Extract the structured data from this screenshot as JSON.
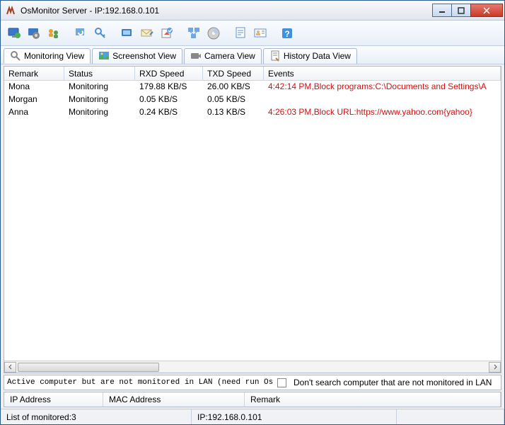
{
  "window": {
    "title": "OsMonitor Server -  IP:192.168.0.101"
  },
  "viewtabs": [
    {
      "label": "Monitoring View",
      "active": true
    },
    {
      "label": "Screenshot View",
      "active": false
    },
    {
      "label": "Camera View",
      "active": false
    },
    {
      "label": "History Data View",
      "active": false
    }
  ],
  "table": {
    "columns": [
      "Remark",
      "Status",
      "RXD Speed",
      "TXD Speed",
      "Events"
    ],
    "rows": [
      {
        "remark": "Mona",
        "status": "Monitoring",
        "rxd": "179.88 KB/S",
        "txd": "26.00 KB/S",
        "events": "4:42:14 PM,Block programs:C:\\Documents and Settings\\A",
        "red": true
      },
      {
        "remark": "Morgan",
        "status": "Monitoring",
        "rxd": "0.05 KB/S",
        "txd": "0.05 KB/S",
        "events": "",
        "red": false
      },
      {
        "remark": "Anna",
        "status": "Monitoring",
        "rxd": "0.24 KB/S",
        "txd": "0.13 KB/S",
        "events": "4:26:03 PM,Block URL:https://www.yahoo.com{yahoo}",
        "red": true
      }
    ]
  },
  "midbar": {
    "left_label": "Active computer but are not monitored in LAN (need run OsMon",
    "right_label": "Don't search computer that are not monitored in LAN"
  },
  "subhead": {
    "ip": "IP Address",
    "mac": "MAC Address",
    "remark": "Remark"
  },
  "statusbar": {
    "count": "List of monitored:3",
    "ip": "IP:192.168.0.101"
  },
  "toolbar_icons": [
    "monitor-icon",
    "settings-icon",
    "users-icon",
    "refresh-icon",
    "key-icon",
    "screenshot-icon",
    "mail-icon",
    "home-icon",
    "network-icon",
    "disc-icon",
    "report-icon",
    "user-card-icon",
    "help-icon"
  ]
}
